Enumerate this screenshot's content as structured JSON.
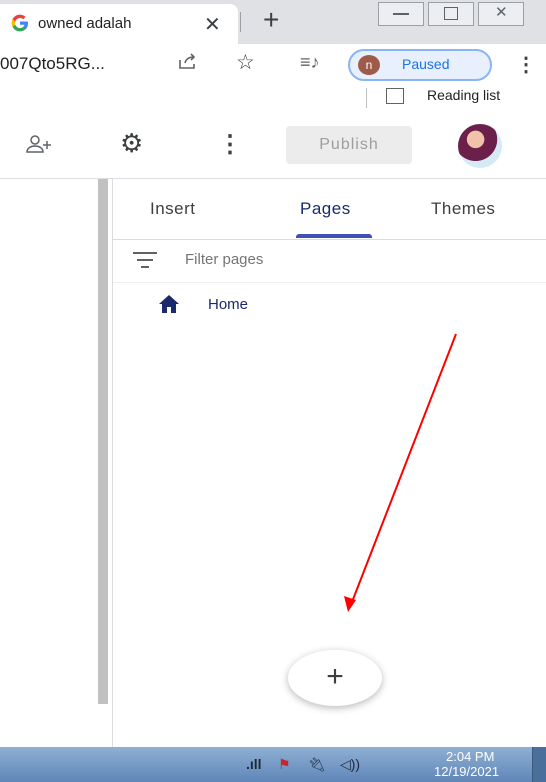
{
  "browser": {
    "tab": {
      "title": "owned adalah"
    },
    "url_fragment": "007Qto5RG...",
    "profile_initial": "n",
    "profile_status": "Paused",
    "reading_list_label": "Reading list"
  },
  "toolbar": {
    "publish_label": "Publish"
  },
  "panel": {
    "tabs": [
      {
        "label": "Insert"
      },
      {
        "label": "Pages"
      },
      {
        "label": "Themes"
      }
    ],
    "active_tab": "Pages",
    "filter_placeholder": "Filter pages",
    "pages": [
      {
        "label": "Home",
        "icon": "home-icon"
      }
    ],
    "add_button_label": "+"
  },
  "annotation": {
    "arrow_color": "#ff0000"
  },
  "colors": {
    "accent": "#3f51b5",
    "page_text": "#1a2a6c"
  },
  "taskbar": {
    "time": "2:04 PM",
    "date": "12/19/2021"
  }
}
